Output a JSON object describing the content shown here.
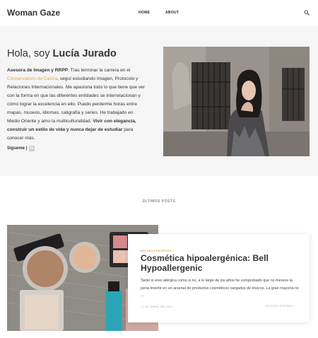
{
  "header": {
    "logo": "Woman Gaze",
    "nav": [
      {
        "label": "HOME"
      },
      {
        "label": "ABOUT"
      }
    ],
    "search_icon": "search-icon"
  },
  "hero": {
    "greeting": "Hola, soy",
    "name": "Lucía Jurado",
    "bio": {
      "role": "Asesora de Imagen y RRPP",
      "part1": ". Tras terminar la carrera en el ",
      "link": "Conservatorio de Danza",
      "part2": ", seguí estudiando Imagen, Protocolo y Relaciones Internacionales. Me apasiona todo lo que tiene que ver con la forma en que las diferentes entidades se interrelacionan y cómo lograr la excelencia en ello. Puedo perderme horas entre mapas, museos, idiomas, caligrafía y series. He trabajado en Medio Oriente y amo la multiculturalidad. ",
      "motto": "Vivir con elegancia, construir un estilo de vida y nunca dejar de estudiar",
      "part3": " para conocer más."
    },
    "follow_label": "Sígueme |",
    "social_icon": "linkedin-icon",
    "accent_color": "#e6a93c"
  },
  "latest": {
    "section_label": "ÚLTIMOS POSTS",
    "post": {
      "category": "BELLEZA ESTÉTICA",
      "title": "Cosmética hipoalergénica: Bell Hypoallergenic",
      "excerpt": "Tanto si eres alérgica como si no, a lo largo de los años he comprobado que no merece la pena invertir en un arsenal de productos cosméticos cargados de tóxicos. La gran mayoría no ...",
      "date": "11 DE ABRIL DE 2022",
      "read_more": "SEGUIR LEYENDO ›"
    }
  }
}
